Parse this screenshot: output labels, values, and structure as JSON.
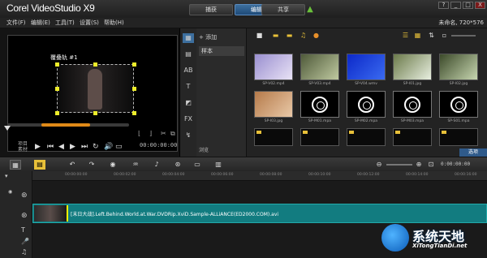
{
  "app": {
    "brand": "Corel VideoStudio X9",
    "project_info": "未命名, 720*576"
  },
  "tabs": [
    {
      "label": "捕获"
    },
    {
      "label": "编辑"
    },
    {
      "label": "共享"
    }
  ],
  "window_controls": {
    "help": "?",
    "minimize": "_",
    "maximize": "□",
    "close": "X"
  },
  "menu": [
    "文件(F)",
    "编辑(E)",
    "工具(T)",
    "设置(S)",
    "帮助(H)"
  ],
  "preview": {
    "subtitle": "覆叠轨 #1",
    "mode_label_1": "项目",
    "mode_label_2": "素材",
    "timecode": "00:00:00:00",
    "scrub_position": 0.33
  },
  "library": {
    "add_label": "添加",
    "folder": "样本",
    "browse_label": "浏览",
    "options_label": "选项",
    "thumbnails": [
      {
        "label": "SP-V02.mp4",
        "kind": "video",
        "colors": [
          "#9a8fd0",
          "#e8e2f5"
        ]
      },
      {
        "label": "SP-V03.mp4",
        "kind": "video",
        "colors": [
          "#4f5a3a",
          "#bfc9a0"
        ]
      },
      {
        "label": "SP-V04.wmv",
        "kind": "video",
        "colors": [
          "#0c29c9",
          "#3a6af0"
        ]
      },
      {
        "label": "SP-I01.jpg",
        "kind": "image",
        "colors": [
          "#6b7a4a",
          "#e8efe0"
        ]
      },
      {
        "label": "SP-I02.jpg",
        "kind": "image",
        "colors": [
          "#3c4a2a",
          "#c7d6b0"
        ]
      },
      {
        "label": "SP-I03.jpg",
        "kind": "image",
        "colors": [
          "#b57a4a",
          "#e9c9a8"
        ]
      },
      {
        "label": "SP-M01.mpa",
        "kind": "audio"
      },
      {
        "label": "SP-M02.mpa",
        "kind": "audio"
      },
      {
        "label": "SP-M03.mpa",
        "kind": "audio"
      },
      {
        "label": "SP-S01.mpa",
        "kind": "audio"
      },
      {
        "label": "",
        "kind": "dark"
      },
      {
        "label": "",
        "kind": "dark"
      },
      {
        "label": "",
        "kind": "dark"
      },
      {
        "label": "",
        "kind": "dark"
      },
      {
        "label": "",
        "kind": "dark"
      }
    ]
  },
  "timeline": {
    "timecode": "0:00:00:00",
    "ruler": [
      "00:00:00:00",
      "00:00:02:00",
      "00:00:04:00",
      "00:00:06:00",
      "00:00:08:00",
      "00:00:10:00",
      "00:00:12:00",
      "00:00:14:00",
      "00:00:16:00",
      "00:00:18:00"
    ],
    "video_clip": "[末日大战].Left.Behind.World.at.War.DVDRip.XviD.Sample-ALLiANCE(ED2000.COM).avi"
  },
  "watermark": {
    "text": "系统天地",
    "url": "XiTongTianDi.net"
  },
  "colors": {
    "accent": "#2f5a8a",
    "clip": "#127c80",
    "handle": "#eded2a",
    "scrub": "#e08a18"
  }
}
